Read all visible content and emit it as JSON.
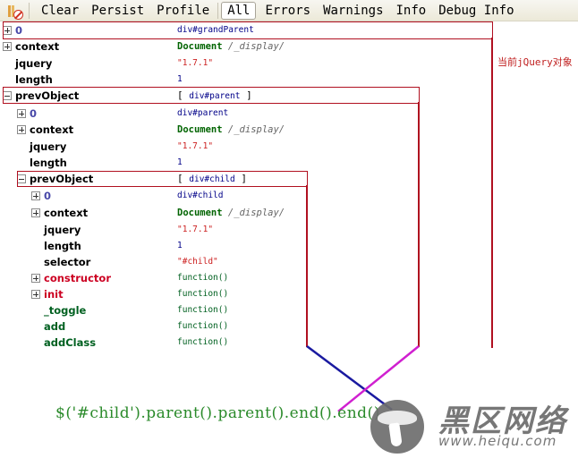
{
  "toolbar": {
    "icon": "clear-console-icon",
    "buttons": [
      "Clear",
      "Persist",
      "Profile"
    ],
    "filters": [
      "All",
      "Errors",
      "Warnings",
      "Info",
      "Debug Info"
    ],
    "active_filter": "All"
  },
  "tree": {
    "rows": [
      {
        "key": "0",
        "value": "div#grandParent",
        "toggle": "plus"
      },
      {
        "key": "context",
        "value_main": "Document",
        "value_path": "/_display/",
        "toggle": "plus"
      },
      {
        "key": "jquery",
        "value": "\"1.7.1\""
      },
      {
        "key": "length",
        "value": "1"
      },
      {
        "key": "prevObject",
        "value_open": "[",
        "value": "div#parent",
        "value_close": "]",
        "toggle": "minus"
      },
      {
        "key": "0",
        "value": "div#parent",
        "toggle": "plus"
      },
      {
        "key": "context",
        "value_main": "Document",
        "value_path": "/_display/",
        "toggle": "plus"
      },
      {
        "key": "jquery",
        "value": "\"1.7.1\""
      },
      {
        "key": "length",
        "value": "1"
      },
      {
        "key": "prevObject",
        "value_open": "[",
        "value": "div#child",
        "value_close": "]",
        "toggle": "minus"
      },
      {
        "key": "0",
        "value": "div#child",
        "toggle": "plus"
      },
      {
        "key": "context",
        "value_main": "Document",
        "value_path": "/_display/",
        "toggle": "plus"
      },
      {
        "key": "jquery",
        "value": "\"1.7.1\""
      },
      {
        "key": "length",
        "value": "1"
      },
      {
        "key": "selector",
        "value": "\"#child\""
      },
      {
        "key": "constructor",
        "value": "function()",
        "toggle": "plus"
      },
      {
        "key": "init",
        "value": "function()",
        "toggle": "plus"
      },
      {
        "key": "_toggle",
        "value": "function()"
      },
      {
        "key": "add",
        "value": "function()"
      },
      {
        "key": "addClass",
        "value": "function()"
      }
    ]
  },
  "annotation": "当前jQuery对象",
  "code_line": "$('#child').parent().parent().end().end()",
  "watermark": {
    "title": "黑区网络",
    "url": "www.heiqu.com"
  },
  "colors": {
    "highlight_box": "#b01020",
    "line_blue": "#1a1aa0",
    "line_magenta": "#d020d0",
    "code": "#2a8a2a"
  }
}
